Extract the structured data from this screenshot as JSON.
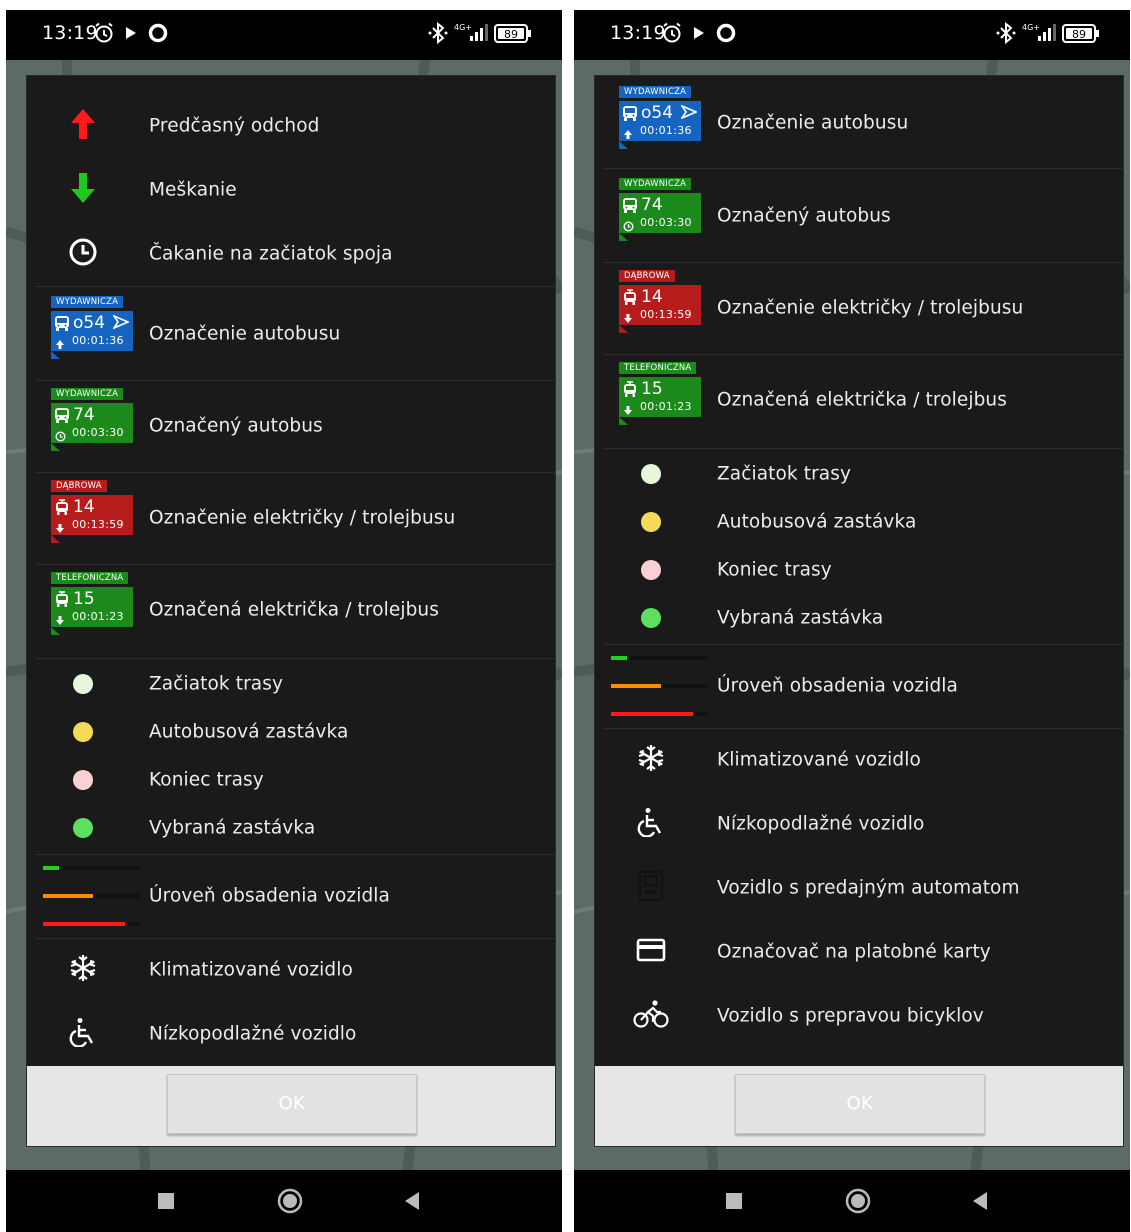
{
  "status": {
    "time": "13:19",
    "battery": "89",
    "network": "4G+"
  },
  "legend": {
    "early_departure": "Predčasný odchod",
    "delay": "Meškanie",
    "waiting_start": "Čakanie na začiatok spoja",
    "bus_marking": "Označenie autobusu",
    "bus_selected": "Označený autobus",
    "tram_marking": "Označenie električky / trolejbusu",
    "tram_selected": "Označená električka / trolejbus",
    "route_start": "Začiatok trasy",
    "bus_stop": "Autobusová zastávka",
    "route_end": "Koniec trasy",
    "selected_stop": "Vybraná zastávka",
    "occupancy": "Úroveň obsadenia vozidla",
    "ac": "Klimatizované vozidlo",
    "low_floor": "Nízkopodlažné vozidlo",
    "ticket_machine": "Vozidlo s predajným automatom",
    "card_validator": "Označovač na platobné karty",
    "bicycle": "Vozidlo s prepravou bicyklov"
  },
  "badges": {
    "bus_marking": {
      "stop": "WYDAWNICZA",
      "line": "o54",
      "time": "00:01:36",
      "color": "#1565c0"
    },
    "bus_selected": {
      "stop": "WYDAWNICZA",
      "line": "74",
      "time": "00:03:30",
      "color": "#1b8a1b"
    },
    "tram_marking": {
      "stop": "DĄBROWA",
      "line": "14",
      "time": "00:13:59",
      "color": "#b71c1c"
    },
    "tram_selected": {
      "stop": "TELEFONICZNA",
      "line": "15",
      "time": "00:01:23",
      "color": "#1b8a1b"
    }
  },
  "colors": {
    "up_arrow": "#ff1a1a",
    "down_arrow": "#1ec81e",
    "start_dot": "#e8f7dc",
    "stop_dot": "#f5da5a",
    "end_dot": "#fbd0d4",
    "selected_dot": "#5ee05e",
    "occ_low": "#1ed21e",
    "occ_mid": "#ff8c00",
    "occ_high": "#ff1a1a"
  },
  "icons": [
    "arrow-up-icon",
    "arrow-down-icon",
    "clock-icon",
    "bus-icon",
    "tram-icon",
    "snowflake-icon",
    "wheelchair-icon",
    "ticket-machine-icon",
    "card-icon",
    "bicycle-icon"
  ],
  "ok_label": "OK"
}
